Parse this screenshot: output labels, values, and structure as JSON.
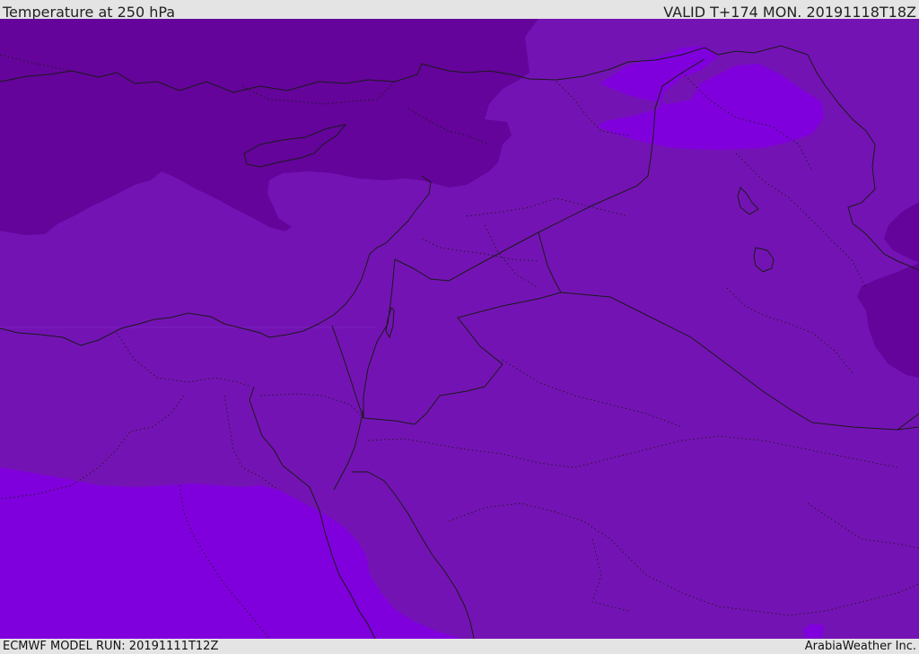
{
  "header": {
    "title": "Temperature at 250 hPa",
    "valid": "VALID T+174 MON. 20191118T18Z"
  },
  "footer": {
    "model_run": "ECMWF MODEL RUN: 20191111T12Z",
    "brand": "ArabiaWeather Inc."
  },
  "colors": {
    "background": "#e4e4e4",
    "field_mid": "#7413b4",
    "field_cold_dark": "#64049a",
    "field_warm": "#8000dd",
    "field_warm_light": "#7a06d2",
    "borders": "#1a1a1a"
  }
}
